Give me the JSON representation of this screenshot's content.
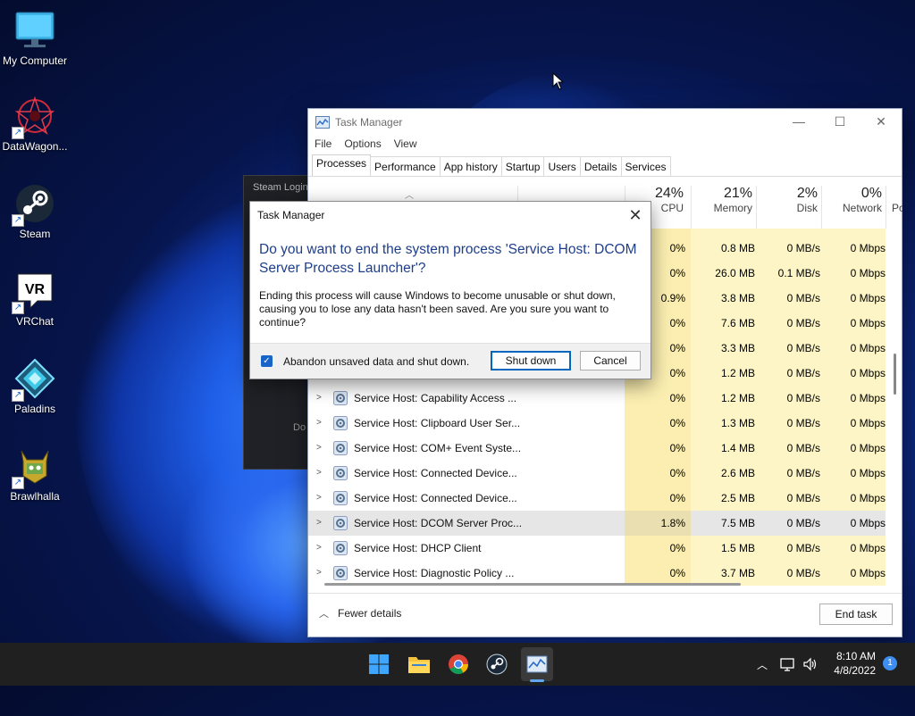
{
  "desktop": {
    "icons": [
      {
        "label": "My Computer"
      },
      {
        "label": "DataWagon..."
      },
      {
        "label": "Steam"
      },
      {
        "label": "VRChat"
      },
      {
        "label": "Paladins"
      },
      {
        "label": "Brawlhalla"
      }
    ]
  },
  "steam_window": {
    "title": "Steam Login",
    "partial_text": "Do"
  },
  "task_manager": {
    "title": "Task Manager",
    "menu": [
      "File",
      "Options",
      "View"
    ],
    "tabs": [
      "Processes",
      "Performance",
      "App history",
      "Startup",
      "Users",
      "Details",
      "Services"
    ],
    "columns": {
      "cpu": {
        "pct": "24%",
        "name": "CPU"
      },
      "memory": {
        "pct": "21%",
        "name": "Memory"
      },
      "disk": {
        "pct": "2%",
        "name": "Disk"
      },
      "network": {
        "pct": "0%",
        "name": "Network"
      },
      "power": {
        "name": "Po"
      }
    },
    "rows": [
      {
        "name": "",
        "cpu": "0%",
        "mem": "0.8 MB",
        "disk": "0 MB/s",
        "net": "0 Mbps"
      },
      {
        "name": "",
        "cpu": "0%",
        "mem": "26.0 MB",
        "disk": "0.1 MB/s",
        "net": "0 Mbps"
      },
      {
        "name": "",
        "cpu": "0.9%",
        "mem": "3.8 MB",
        "disk": "0 MB/s",
        "net": "0 Mbps"
      },
      {
        "name": "",
        "cpu": "0%",
        "mem": "7.6 MB",
        "disk": "0 MB/s",
        "net": "0 Mbps"
      },
      {
        "name": "",
        "cpu": "0%",
        "mem": "3.3 MB",
        "disk": "0 MB/s",
        "net": "0 Mbps"
      },
      {
        "name": "",
        "cpu": "0%",
        "mem": "1.2 MB",
        "disk": "0 MB/s",
        "net": "0 Mbps"
      },
      {
        "name": "Service Host: Capability Access ...",
        "cpu": "0%",
        "mem": "1.2 MB",
        "disk": "0 MB/s",
        "net": "0 Mbps"
      },
      {
        "name": "Service Host: Clipboard User Ser...",
        "cpu": "0%",
        "mem": "1.3 MB",
        "disk": "0 MB/s",
        "net": "0 Mbps"
      },
      {
        "name": "Service Host: COM+ Event Syste...",
        "cpu": "0%",
        "mem": "1.4 MB",
        "disk": "0 MB/s",
        "net": "0 Mbps"
      },
      {
        "name": "Service Host: Connected Device...",
        "cpu": "0%",
        "mem": "2.6 MB",
        "disk": "0 MB/s",
        "net": "0 Mbps"
      },
      {
        "name": "Service Host: Connected Device...",
        "cpu": "0%",
        "mem": "2.5 MB",
        "disk": "0 MB/s",
        "net": "0 Mbps"
      },
      {
        "name": "Service Host: DCOM Server Proc...",
        "cpu": "1.8%",
        "mem": "7.5 MB",
        "disk": "0 MB/s",
        "net": "0 Mbps",
        "selected": true
      },
      {
        "name": "Service Host: DHCP Client",
        "cpu": "0%",
        "mem": "1.5 MB",
        "disk": "0 MB/s",
        "net": "0 Mbps"
      },
      {
        "name": "Service Host: Diagnostic Policy ...",
        "cpu": "0%",
        "mem": "3.7 MB",
        "disk": "0 MB/s",
        "net": "0 Mbps"
      }
    ],
    "fewer_details": "Fewer details",
    "end_task": "End task"
  },
  "dialog": {
    "title": "Task Manager",
    "heading": "Do you want to end the system process 'Service Host: DCOM Server Process Launcher'?",
    "body": "Ending this process will cause Windows to become unusable or shut down, causing you to lose any data hasn't been saved. Are you sure you want to continue?",
    "checkbox_label": "Abandon unsaved data and shut down.",
    "checkbox_checked": true,
    "primary_button": "Shut down",
    "cancel_button": "Cancel"
  },
  "taskbar": {
    "apps": [
      "start-icon",
      "file-explorer-icon",
      "chrome-icon",
      "steam-icon",
      "task-manager-icon"
    ],
    "time": "8:10 AM",
    "date": "4/8/2022",
    "notification_count": "1"
  }
}
